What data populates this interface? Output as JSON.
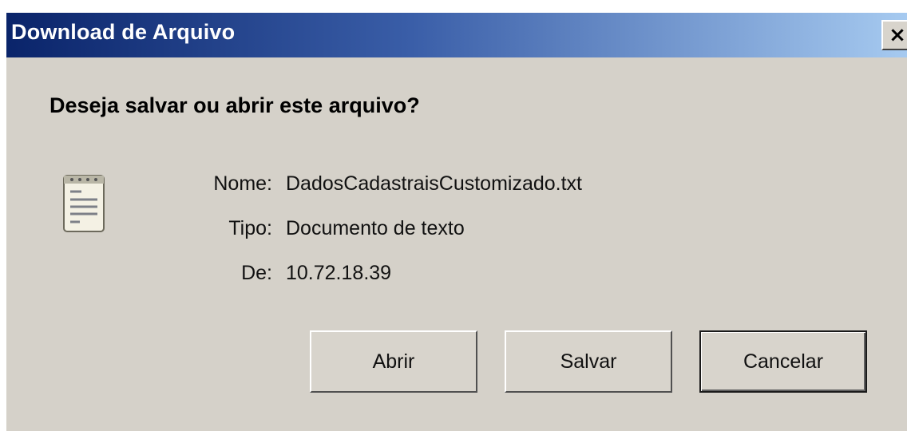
{
  "dialog": {
    "title": "Download de Arquivo",
    "close_label": "×",
    "question": "Deseja salvar ou abrir este arquivo?",
    "file_icon": "text-document-icon",
    "fields": [
      {
        "label": "Nome:",
        "value": "DadosCadastraisCustomizado.txt"
      },
      {
        "label": "Tipo:",
        "value": "Documento de texto"
      },
      {
        "label": "De:",
        "value": "10.72.18.39"
      }
    ],
    "buttons": {
      "open_label": "Abrir",
      "save_label": "Salvar",
      "cancel_label": "Cancelar"
    }
  },
  "colors": {
    "titlebar_start": "#0a246a",
    "titlebar_end": "#a6caf0",
    "dialog_background": "#d5d1c9"
  }
}
